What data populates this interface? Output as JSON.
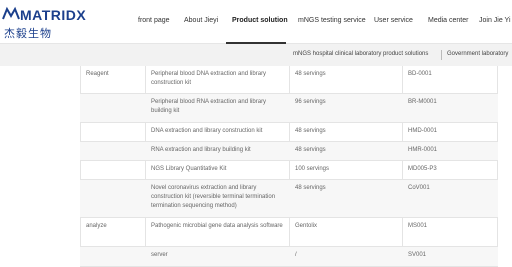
{
  "brand": {
    "name": "MATRIDX",
    "cn": "杰毅生物"
  },
  "nav": {
    "items": [
      "front page",
      "About Jieyi",
      "Product solution",
      "mNGS testing service",
      "User service",
      "Media center",
      "Join Jie Yi"
    ]
  },
  "subnav": {
    "items": [
      "mNGS hospital clinical laboratory product solutions",
      "Government laboratory"
    ]
  },
  "table": {
    "rows": [
      {
        "category": "Reagent",
        "name": "Peripheral blood DNA extraction and library construction kit",
        "spec": "48 servings",
        "code": "BD-0001"
      },
      {
        "category": "",
        "name": "Peripheral blood RNA extraction and library building kit",
        "spec": "96 servings",
        "code": "BR-M0001"
      },
      {
        "category": "",
        "name": "DNA extraction and library construction kit",
        "spec": "48 servings",
        "code": "HMD-0001"
      },
      {
        "category": "",
        "name": "RNA extraction and library building kit",
        "spec": "48 servings",
        "code": "HMR-0001"
      },
      {
        "category": "",
        "name": "NGS Library Quantitative Kit",
        "spec": "100 servings",
        "code": "MD005-P3"
      },
      {
        "category": "",
        "name": "Novel coronavirus extraction and library construction kit (reversible terminal termination termination sequencing method)",
        "spec": "48 servings",
        "code": "CoV001"
      },
      {
        "category": "analyze",
        "name": "Pathogenic microbial gene data analysis software",
        "spec": "Gentolix",
        "code": "MS001"
      },
      {
        "category": "",
        "name": "server",
        "spec": "/",
        "code": "SV001"
      }
    ]
  }
}
